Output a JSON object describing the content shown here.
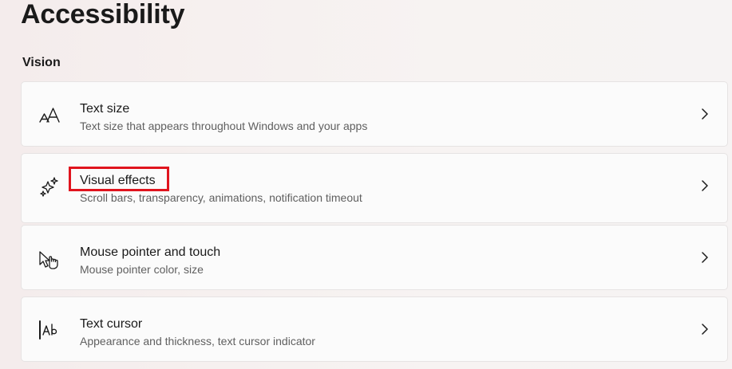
{
  "page": {
    "title": "Accessibility"
  },
  "section": {
    "title": "Vision"
  },
  "items": [
    {
      "title": "Text size",
      "description": "Text size that appears throughout Windows and your apps",
      "icon": "text-size-icon"
    },
    {
      "title": "Visual effects",
      "description": "Scroll bars, transparency, animations, notification timeout",
      "icon": "sparkle-icon",
      "highlighted": true,
      "highlight_color": "#e0141e"
    },
    {
      "title": "Mouse pointer and touch",
      "description": "Mouse pointer color, size",
      "icon": "mouse-pointer-touch-icon"
    },
    {
      "title": "Text cursor",
      "description": "Appearance and thickness, text cursor indicator",
      "icon": "text-cursor-icon"
    }
  ],
  "colors": {
    "card_background": "#fbfbfb",
    "card_border": "#e6e3e3",
    "highlight": "#e0141e"
  }
}
